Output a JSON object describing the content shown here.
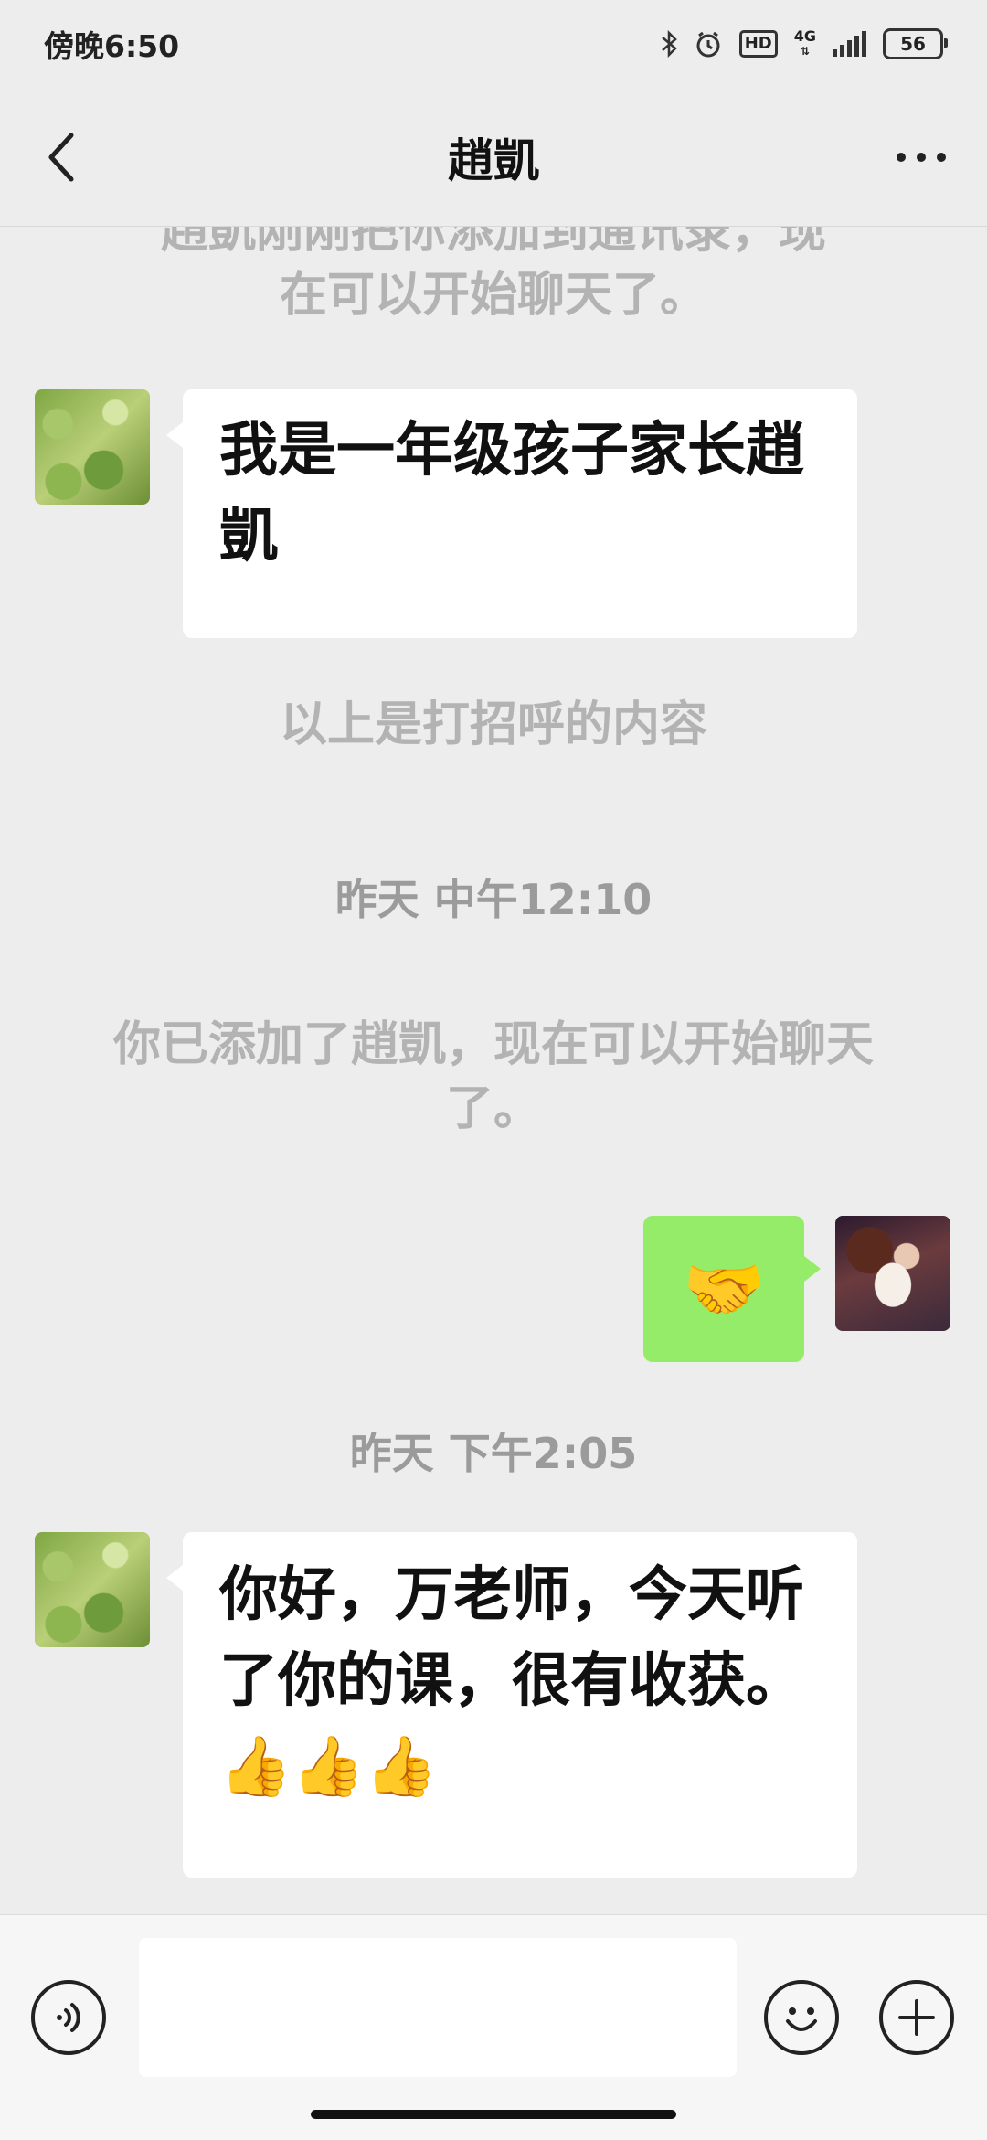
{
  "status_bar": {
    "time": "傍晚6:50",
    "hd": "HD",
    "network": "4G",
    "battery": "56"
  },
  "header": {
    "title": "趙凱"
  },
  "chat": {
    "partial_system_top": "趙凱刚刚把你添加到通讯录，现",
    "partial_system_bottom": "在可以开始聊天了。",
    "greeting_message": "我是一年级孩子家长趙凱",
    "greeting_note": "以上是打招呼的内容",
    "time_1": "昨天 中午12:10",
    "system_added": "你已添加了趙凱，现在可以开始聊天了。",
    "sent_emoji": "🤝",
    "time_2": "昨天 下午2:05",
    "received_message": "你好，万老师，今天听了你的课，很有收获。👍👍👍"
  },
  "input": {
    "placeholder": ""
  }
}
